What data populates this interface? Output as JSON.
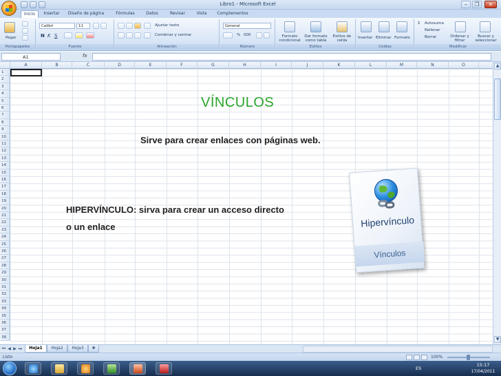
{
  "window": {
    "title": "Libro1 - Microsoft Excel",
    "minimize": "–",
    "restore": "❐",
    "close": "✕"
  },
  "tabs": [
    "Inicio",
    "Insertar",
    "Diseño de página",
    "Fórmulas",
    "Datos",
    "Revisar",
    "Vista",
    "Complementos"
  ],
  "ribbon": {
    "clipboard": {
      "label": "Portapapeles",
      "paste": "Pegar"
    },
    "font": {
      "label": "Fuente",
      "name": "Calibri",
      "size": "11",
      "bold": "N",
      "italic": "K",
      "underline": "S"
    },
    "alignment": {
      "label": "Alineación",
      "wrap": "Ajustar texto",
      "merge": "Combinar y centrar"
    },
    "number": {
      "label": "Número",
      "format": "General",
      "percent": "%",
      "thousands": "000"
    },
    "styles": {
      "label": "Estilos",
      "conditional": "Formato condicional",
      "table": "Dar formato como tabla",
      "cell": "Estilos de celda"
    },
    "cells": {
      "label": "Celdas",
      "insert": "Insertar",
      "delete": "Eliminar",
      "format": "Formato"
    },
    "editing": {
      "label": "Modificar",
      "autosum": "Autosuma",
      "fill": "Rellenar",
      "clear": "Borrar",
      "sort": "Ordenar y filtrar",
      "find": "Buscar y seleccionar"
    }
  },
  "formula_bar": {
    "name_box": "A1",
    "fx": "fx",
    "value": ""
  },
  "columns": [
    "A",
    "B",
    "C",
    "D",
    "E",
    "F",
    "G",
    "H",
    "I",
    "J",
    "K",
    "L",
    "M",
    "N",
    "O"
  ],
  "rows": [
    "1",
    "2",
    "3",
    "4",
    "5",
    "6",
    "7",
    "8",
    "9",
    "10",
    "11",
    "12",
    "13",
    "14",
    "15",
    "16",
    "17",
    "18",
    "19",
    "20",
    "21",
    "22",
    "23",
    "24",
    "25",
    "26",
    "27",
    "28",
    "29",
    "30",
    "31",
    "32",
    "33",
    "34",
    "35",
    "36",
    "37",
    "38"
  ],
  "content": {
    "heading": "VÍNCULOS",
    "description": "Sirve para crear enlaces con páginas web.",
    "hyperlink_line1": "HIPERVÍNCULO: sirva para crear un acceso directo",
    "hyperlink_line2": "o un enlace",
    "card_label": "Hipervínculo",
    "card_group": "Vínculos"
  },
  "sheets": {
    "tabs": [
      "Hoja1",
      "Hoja2",
      "Hoja3"
    ],
    "active": "Hoja1"
  },
  "status": {
    "text": "Listo",
    "zoom": "100%"
  },
  "taskbar": {
    "language": "ES",
    "time": "15:17",
    "date": "17/04/2011"
  },
  "colors": {
    "heading": "#2aa52a",
    "ribbon": "#d9e6f6",
    "taskbar": "#172e4f"
  }
}
